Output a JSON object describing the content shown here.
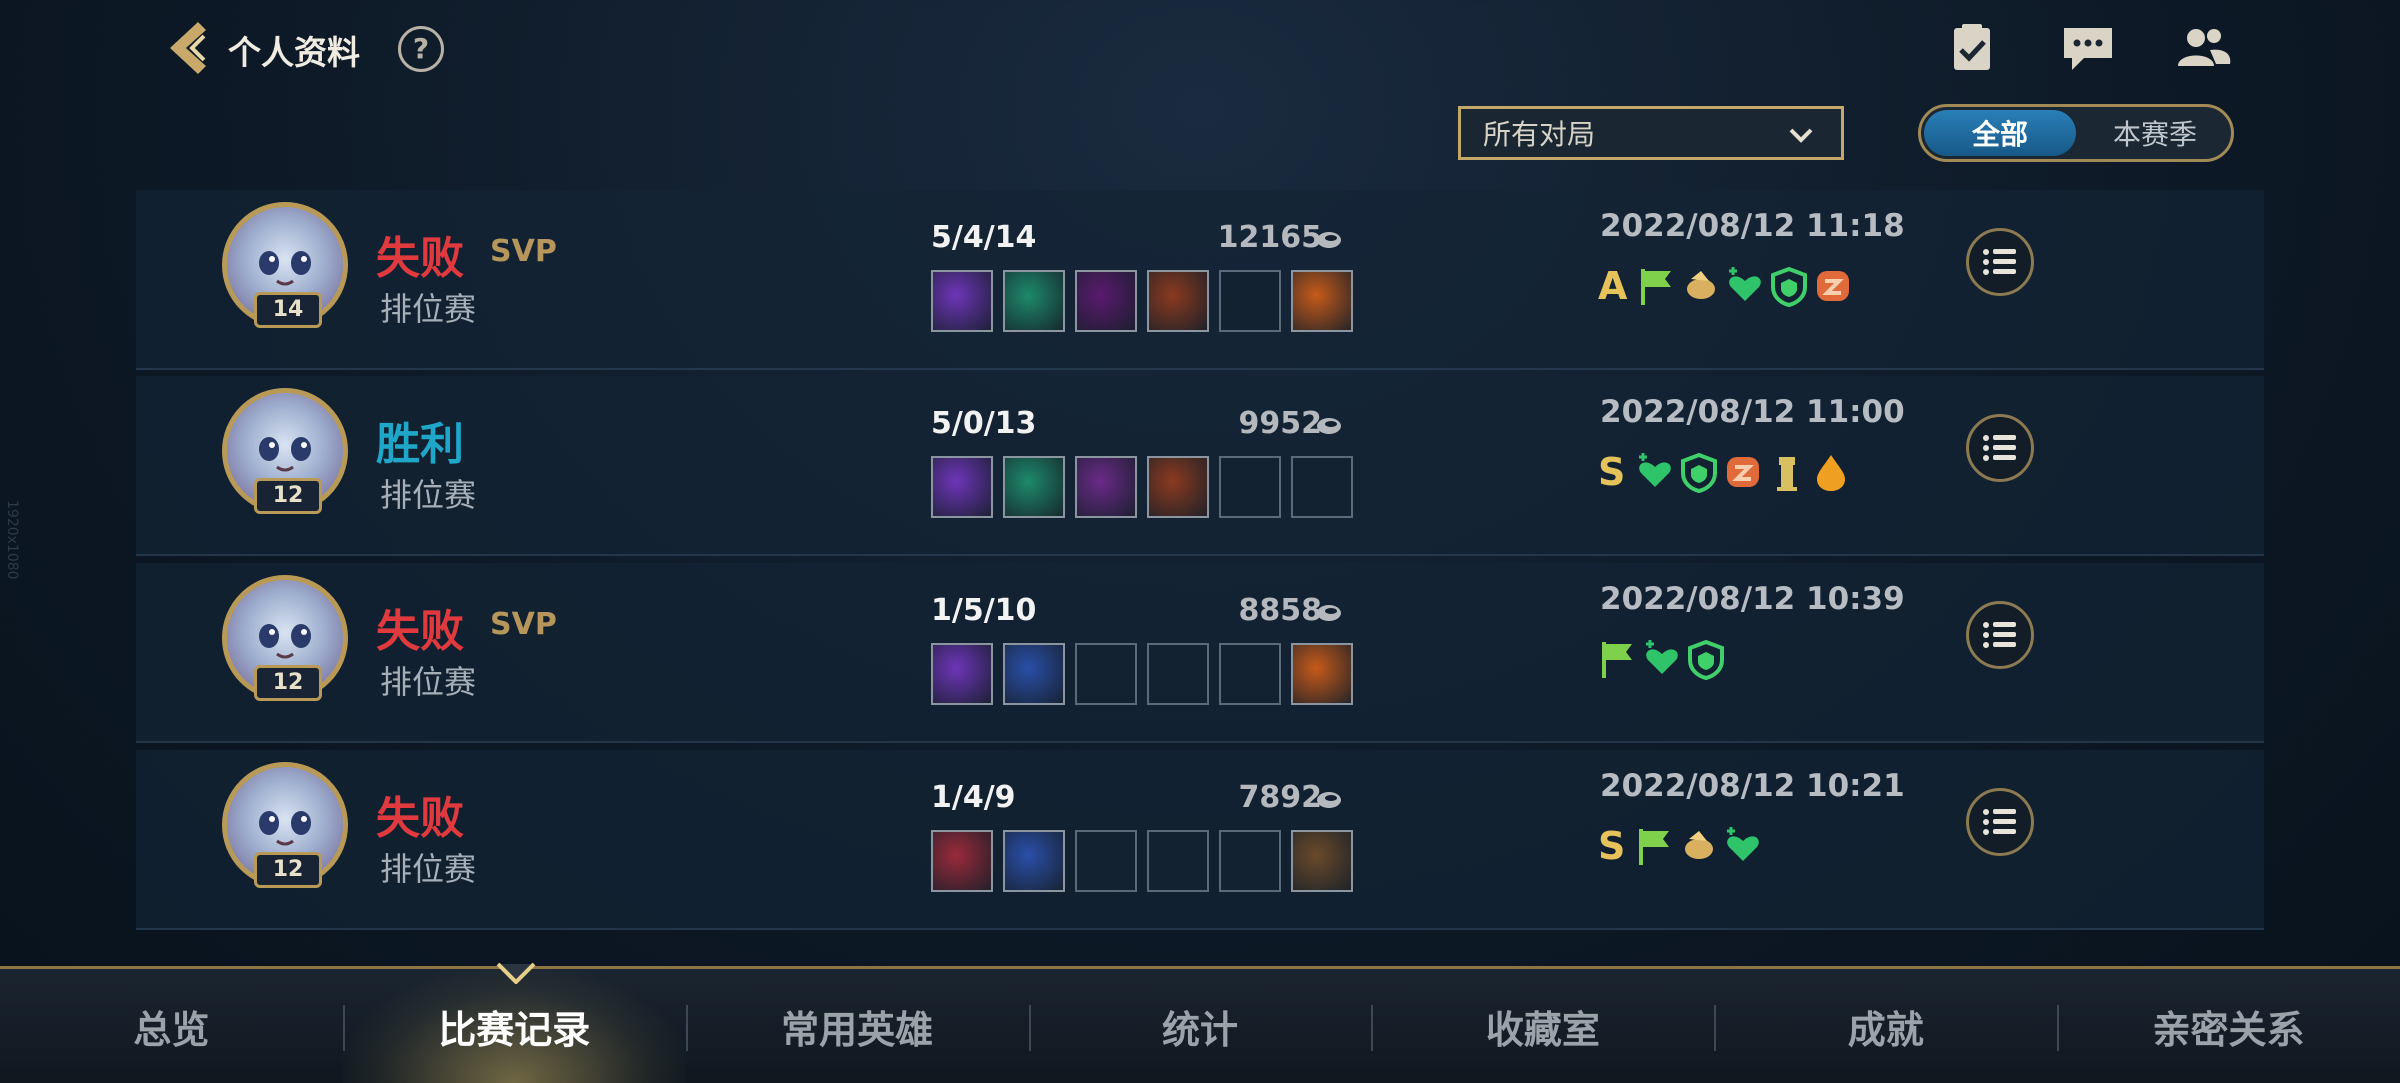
{
  "header": {
    "title": "个人资料",
    "help": "?"
  },
  "filter": {
    "dropdown_value": "所有对局",
    "seg_all": "全部",
    "seg_season": "本赛季"
  },
  "matches": [
    {
      "result": "失败",
      "result_type": "lose",
      "svp": "SVP",
      "mode": "排位赛",
      "level": "14",
      "kda": "5/4/14",
      "gold": "12165",
      "time": "2022/08/12 11:18",
      "grade": "A",
      "badges": [
        "flag",
        "bird",
        "heart",
        "shield",
        "swirl"
      ]
    },
    {
      "result": "胜利",
      "result_type": "win",
      "svp": "",
      "mode": "排位赛",
      "level": "12",
      "kda": "5/0/13",
      "gold": "9952",
      "time": "2022/08/12 11:00",
      "grade": "S",
      "badges": [
        "heart",
        "shield",
        "swirl",
        "tower",
        "drop"
      ]
    },
    {
      "result": "失败",
      "result_type": "lose",
      "svp": "SVP",
      "mode": "排位赛",
      "level": "12",
      "kda": "1/5/10",
      "gold": "8858",
      "time": "2022/08/12 10:39",
      "grade": "",
      "badges": [
        "flag",
        "heart",
        "shield"
      ]
    },
    {
      "result": "失败",
      "result_type": "lose",
      "svp": "",
      "mode": "排位赛",
      "level": "12",
      "kda": "1/4/9",
      "gold": "7892",
      "time": "2022/08/12 10:21",
      "grade": "S",
      "badges": [
        "flag",
        "bird",
        "heart"
      ]
    }
  ],
  "nav": [
    "总览",
    "比赛记录",
    "常用英雄",
    "统计",
    "收藏室",
    "成就",
    "亲密关系"
  ],
  "nav_active_index": 1,
  "watermark": "1920x1080"
}
